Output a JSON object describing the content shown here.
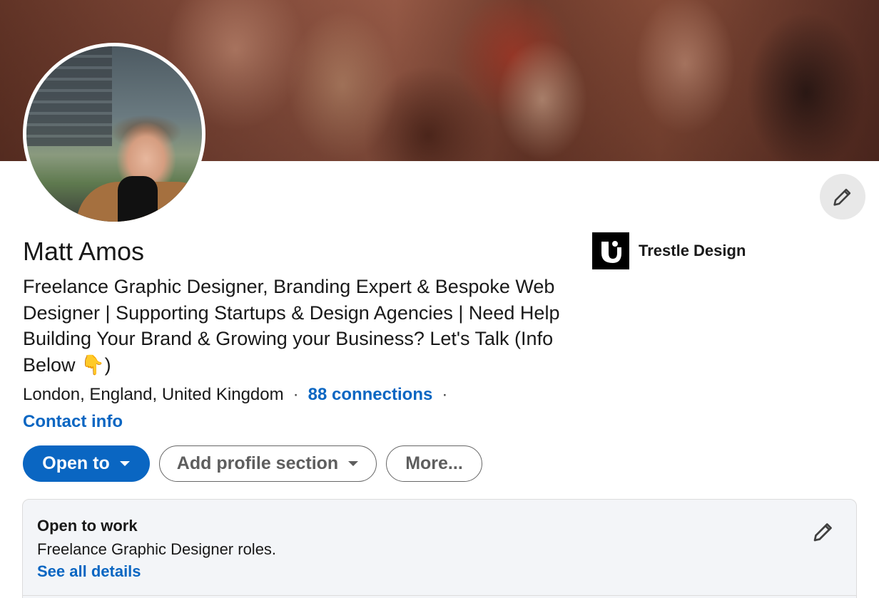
{
  "profile": {
    "name": "Matt Amos",
    "headline": "Freelance Graphic Designer, Branding Expert & Bespoke Web Designer | Supporting Startups & Design Agencies | Need Help Building Your Brand & Growing your Business? Let's Talk (Info Below 👇)",
    "location": "London, England, United Kingdom",
    "connections": "88 connections",
    "contact_info": "Contact info"
  },
  "company": {
    "name": "Trestle Design"
  },
  "actions": {
    "open_to": "Open to",
    "add_profile_section": "Add profile section",
    "more": "More..."
  },
  "open_to_work": {
    "title": "Open to work",
    "description": "Freelance Graphic Designer roles.",
    "details_link": "See all details"
  },
  "icons": {
    "edit_intro": "pencil-icon",
    "dropdown": "caret-down-icon",
    "edit_open_to_work": "pencil-icon"
  },
  "colors": {
    "link": "#0a66c2",
    "primary_button": "#0a66c2",
    "card_background": "#f3f5f8"
  }
}
